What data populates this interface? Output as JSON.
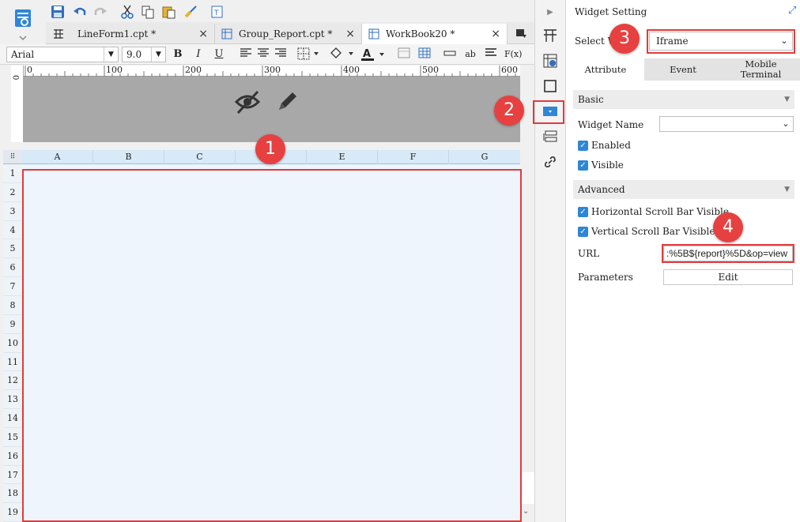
{
  "tabs": [
    {
      "label": "LineForm1.cpt *"
    },
    {
      "label": "Group_Report.cpt *"
    },
    {
      "label": "WorkBook20 *"
    }
  ],
  "format_bar": {
    "font": "Arial",
    "size": "9.0",
    "bold": "B",
    "italic": "I",
    "underline": "U",
    "text_label": "ab",
    "formula": "F(x)"
  },
  "ruler": {
    "marks": [
      "0",
      "100",
      "200",
      "300",
      "400",
      "500",
      "600"
    ],
    "vertical_mark": "0"
  },
  "grid": {
    "columns": [
      "A",
      "B",
      "",
      "C",
      "",
      "E",
      "F",
      "G"
    ],
    "columns_display": [
      "A",
      "B",
      "C",
      "",
      "E",
      "F",
      "G"
    ],
    "rows": [
      "1",
      "2",
      "3",
      "4",
      "5",
      "6",
      "7",
      "8",
      "9",
      "10",
      "11",
      "12",
      "13",
      "14",
      "15",
      "16",
      "17",
      "18",
      "19"
    ]
  },
  "badges": [
    "1",
    "2",
    "3",
    "4"
  ],
  "panel": {
    "title": "Widget Setting",
    "select_label": "Select W",
    "widget_type": "Iframe",
    "tabs": [
      "Attribute",
      "Event",
      "Mobile\nTerminal"
    ],
    "tab_attribute": "Attribute",
    "tab_event": "Event",
    "tab_mobile": "Mobile Terminal",
    "basic": "Basic",
    "widget_name_label": "Widget Name",
    "enabled": "Enabled",
    "visible": "Visible",
    "advanced": "Advanced",
    "hscroll": "Horizontal Scroll Bar Visible",
    "vscroll": "Vertical Scroll Bar Visible",
    "url_label": "URL",
    "url_value": ":%5B${report}%5D&op=view",
    "params_label": "Parameters",
    "edit_label": "Edit"
  },
  "colors": {
    "accent": "#2f86d6",
    "highlight": "#e23b3b",
    "grid_bg": "#eef5fc"
  }
}
